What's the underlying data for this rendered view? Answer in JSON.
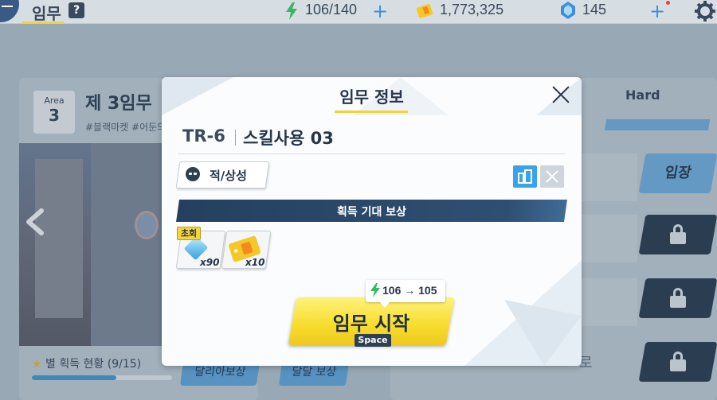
{
  "topbar": {
    "title": "임무",
    "help_label": "?",
    "stamina": "106/140",
    "credits": "1,773,325",
    "gems": "145",
    "plus": "+"
  },
  "area": {
    "badge_label": "Area",
    "badge_number": "3",
    "title": "제 3임무",
    "tags": "#블랙마켓 #어둔의"
  },
  "left_panel": {
    "star_status": "별 획득 현황 (9/15)",
    "star_progress": 0.6,
    "button_1": "달리아보상",
    "button_2": "달달 보상"
  },
  "right_panel": {
    "difficulty_tab": "Hard",
    "enter_label": "입장",
    "bg_text": "로"
  },
  "modal": {
    "title": "임무 정보",
    "stage_code": "TR-6",
    "stage_name": "스킬사용 03",
    "enemy_button_label": "적/상성",
    "reward_banner": "획득 기대 보상",
    "first_clear_badge": "초회",
    "rewards": [
      {
        "icon": "gem-icon",
        "quantity": "x90"
      },
      {
        "icon": "ticket-icon",
        "quantity": "x10"
      }
    ],
    "stamina_cost": "106 → 105",
    "start_button_label": "임무 시작",
    "shortcut_label": "Space"
  },
  "colors": {
    "accent_yellow": "#f2d33a",
    "navy": "#26364a",
    "blue": "#3aa3e8",
    "stamina_green": "#38b865"
  }
}
